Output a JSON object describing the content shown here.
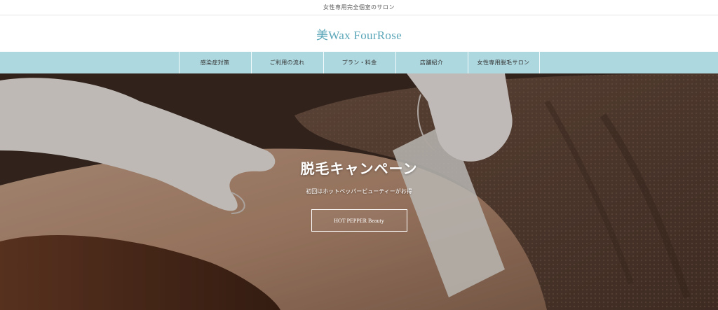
{
  "header": {
    "tagline": "女性専用完全個室のサロン",
    "logo_text": "美Wax FourRose"
  },
  "nav": {
    "items": [
      {
        "label": "感染症対策"
      },
      {
        "label": "ご利用の流れ"
      },
      {
        "label": "プラン・料金"
      },
      {
        "label": "店舗紹介"
      },
      {
        "label": "女性専用脱毛サロン"
      }
    ]
  },
  "hero": {
    "title": "脱毛キャンペーン",
    "subtitle": "初回はホットペッパービューティーがお得",
    "button_label": "HOT PEPPER Beauty"
  },
  "colors": {
    "accent": "#5aa6b8",
    "nav_background": "#aed8df"
  }
}
